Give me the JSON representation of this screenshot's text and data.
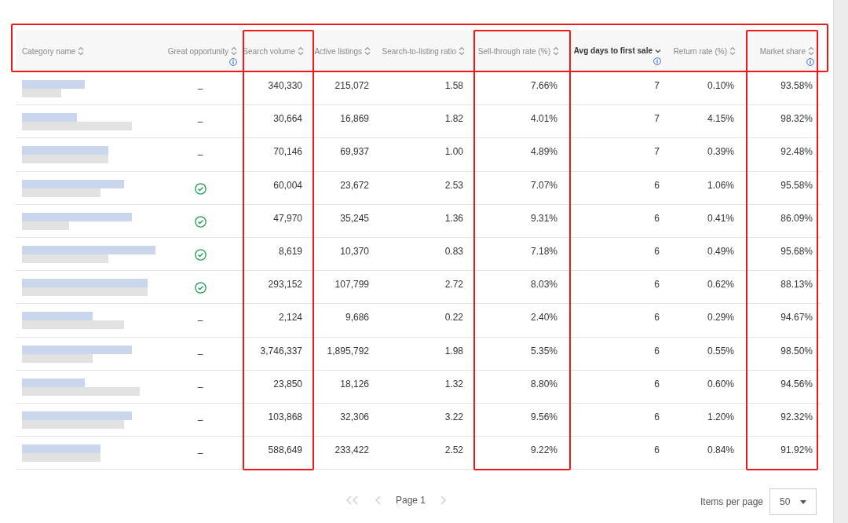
{
  "table": {
    "highlight_header": true,
    "columns": [
      {
        "label": "Category name",
        "sorted": false,
        "info": false,
        "highlighted": false
      },
      {
        "label": "Great opportunity",
        "sorted": false,
        "info": true,
        "highlighted": false
      },
      {
        "label": "Search volume",
        "sorted": false,
        "info": false,
        "highlighted": true
      },
      {
        "label": "Active listings",
        "sorted": false,
        "info": false,
        "highlighted": false
      },
      {
        "label": "Search-to-listing ratio",
        "sorted": false,
        "info": false,
        "highlighted": false
      },
      {
        "label": "Sell-through rate (%)",
        "sorted": false,
        "info": false,
        "highlighted": true
      },
      {
        "label": "Avg days to first sale",
        "sorted": true,
        "info": true,
        "highlighted": false
      },
      {
        "label": "Return rate (%)",
        "sorted": false,
        "info": false,
        "highlighted": false
      },
      {
        "label": "Market share",
        "sorted": false,
        "info": true,
        "highlighted": true
      }
    ],
    "rows": [
      {
        "opportunity": {
          "kind": "dash",
          "text": "–"
        },
        "search_volume": "340,330",
        "active_listings": "215,072",
        "ratio": "1.58",
        "sell_through": "7.66%",
        "avg_days": "7",
        "return_rate": "0.10%",
        "market_share": "93.58%"
      },
      {
        "opportunity": {
          "kind": "dash",
          "text": "–"
        },
        "search_volume": "30,664",
        "active_listings": "16,869",
        "ratio": "1.82",
        "sell_through": "4.01%",
        "avg_days": "7",
        "return_rate": "4.15%",
        "market_share": "98.32%"
      },
      {
        "opportunity": {
          "kind": "dash",
          "text": "–"
        },
        "search_volume": "70,146",
        "active_listings": "69,937",
        "ratio": "1.00",
        "sell_through": "4.89%",
        "avg_days": "7",
        "return_rate": "0.39%",
        "market_share": "92.48%"
      },
      {
        "opportunity": {
          "kind": "check"
        },
        "search_volume": "60,004",
        "active_listings": "23,672",
        "ratio": "2.53",
        "sell_through": "7.07%",
        "avg_days": "6",
        "return_rate": "1.06%",
        "market_share": "95.58%"
      },
      {
        "opportunity": {
          "kind": "check"
        },
        "search_volume": "47,970",
        "active_listings": "35,245",
        "ratio": "1.36",
        "sell_through": "9.31%",
        "avg_days": "6",
        "return_rate": "0.41%",
        "market_share": "86.09%"
      },
      {
        "opportunity": {
          "kind": "check"
        },
        "search_volume": "8,619",
        "active_listings": "10,370",
        "ratio": "0.83",
        "sell_through": "7.18%",
        "avg_days": "6",
        "return_rate": "0.49%",
        "market_share": "95.68%"
      },
      {
        "opportunity": {
          "kind": "check"
        },
        "search_volume": "293,152",
        "active_listings": "107,799",
        "ratio": "2.72",
        "sell_through": "8.03%",
        "avg_days": "6",
        "return_rate": "0.62%",
        "market_share": "88.13%"
      },
      {
        "opportunity": {
          "kind": "dash",
          "text": "–"
        },
        "search_volume": "2,124",
        "active_listings": "9,686",
        "ratio": "0.22",
        "sell_through": "2.40%",
        "avg_days": "6",
        "return_rate": "0.29%",
        "market_share": "94.67%"
      },
      {
        "opportunity": {
          "kind": "dash",
          "text": "–"
        },
        "search_volume": "3,746,337",
        "active_listings": "1,895,792",
        "ratio": "1.98",
        "sell_through": "5.35%",
        "avg_days": "6",
        "return_rate": "0.55%",
        "market_share": "98.50%"
      },
      {
        "opportunity": {
          "kind": "dash",
          "text": "–"
        },
        "search_volume": "23,850",
        "active_listings": "18,126",
        "ratio": "1.32",
        "sell_through": "8.80%",
        "avg_days": "6",
        "return_rate": "0.60%",
        "market_share": "94.56%"
      },
      {
        "opportunity": {
          "kind": "dash",
          "text": "–"
        },
        "search_volume": "103,868",
        "active_listings": "32,306",
        "ratio": "3.22",
        "sell_through": "9.56%",
        "avg_days": "6",
        "return_rate": "1.20%",
        "market_share": "92.32%"
      },
      {
        "opportunity": {
          "kind": "dash",
          "text": "–"
        },
        "search_volume": "588,649",
        "active_listings": "233,422",
        "ratio": "2.52",
        "sell_through": "9.22%",
        "avg_days": "6",
        "return_rate": "0.84%",
        "market_share": "91.92%"
      }
    ]
  },
  "pagination": {
    "first_disabled": true,
    "prev_disabled": true,
    "page": "Page 1",
    "next_disabled": true,
    "items_per_page_label": "Items per page",
    "items_per_page": "50"
  }
}
